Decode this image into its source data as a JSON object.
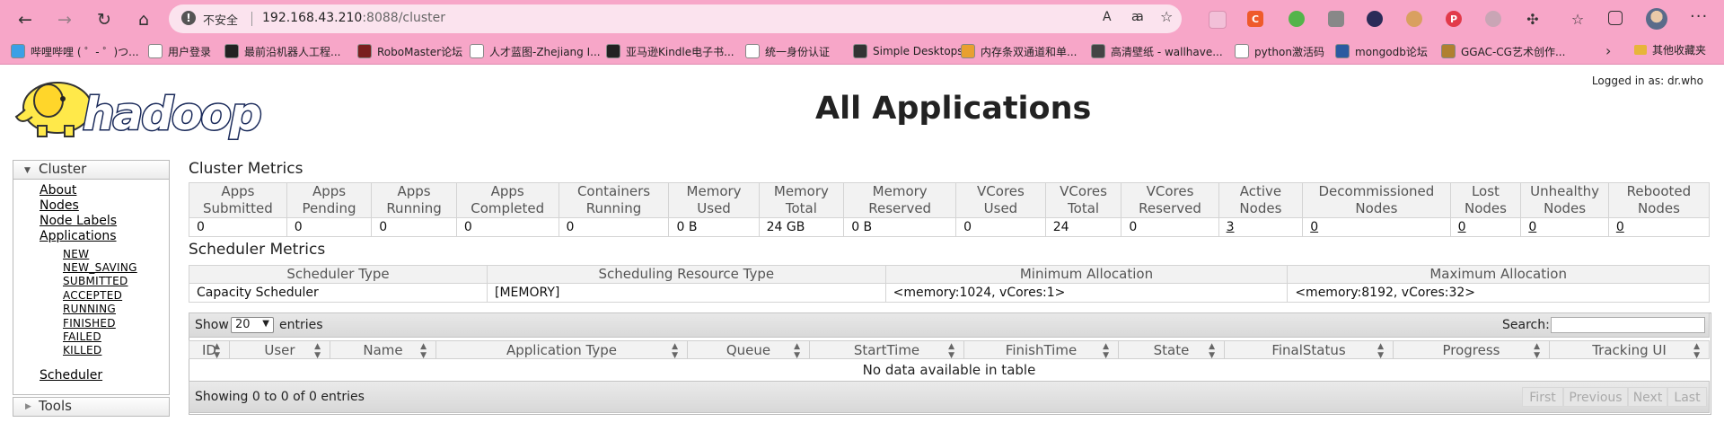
{
  "browser": {
    "back_icon": "←",
    "forward_icon": "→",
    "reload_icon": "↻",
    "home_icon": "⌂",
    "security_label": "不安全",
    "url_host": "192.168.43.210",
    "url_rest": ":8088/cluster",
    "read_aloud_icon": "A",
    "translate_icon": "ꜳ",
    "favorite_icon": "☆",
    "menu_icon": "···",
    "bookmarks": [
      {
        "label": "哔哩哔哩 ( ゜- ゜)つ...",
        "color": "#3aa0e6"
      },
      {
        "label": "用户登录",
        "color": "#ffffff"
      },
      {
        "label": "最前沿机器人工程...",
        "color": "#222222"
      },
      {
        "label": "RoboMaster论坛",
        "color": "#7a1e1e"
      },
      {
        "label": "人才蓝图-Zhejiang I...",
        "color": "#ffffff"
      },
      {
        "label": "亚马逊Kindle电子书...",
        "color": "#222222"
      },
      {
        "label": "统一身份认证",
        "color": "#ffffff"
      },
      {
        "label": "Simple Desktops",
        "color": "#333333"
      },
      {
        "label": "内存条双通道和单...",
        "color": "#e8a030"
      },
      {
        "label": "高清壁纸 - wallhave...",
        "color": "#444444"
      },
      {
        "label": "python激活码",
        "color": "#ffffff"
      },
      {
        "label": "mongodb论坛",
        "color": "#2a5aa0"
      },
      {
        "label": "GGAC-CG艺术创作...",
        "color": "#b08030"
      }
    ],
    "bookmarks_folder": "其他收藏夹"
  },
  "header": {
    "logged_in": "Logged in as: dr.who",
    "title": "All Applications",
    "logo_text": "hadoop"
  },
  "sidebar": {
    "cluster_label": "Cluster",
    "links": [
      "About",
      "Nodes",
      "Node Labels",
      "Applications"
    ],
    "app_states": [
      "NEW",
      "NEW_SAVING",
      "SUBMITTED",
      "ACCEPTED",
      "RUNNING",
      "FINISHED",
      "FAILED",
      "KILLED"
    ],
    "scheduler_link": "Scheduler",
    "tools_label": "Tools"
  },
  "cluster_metrics": {
    "title": "Cluster Metrics",
    "headers": [
      [
        "Apps",
        "Submitted"
      ],
      [
        "Apps",
        "Pending"
      ],
      [
        "Apps",
        "Running"
      ],
      [
        "Apps",
        "Completed"
      ],
      [
        "Containers",
        "Running"
      ],
      [
        "Memory",
        "Used"
      ],
      [
        "Memory",
        "Total"
      ],
      [
        "Memory",
        "Reserved"
      ],
      [
        "VCores",
        "Used"
      ],
      [
        "VCores",
        "Total"
      ],
      [
        "VCores",
        "Reserved"
      ],
      [
        "Active",
        "Nodes"
      ],
      [
        "Decommissioned",
        "Nodes"
      ],
      [
        "Lost",
        "Nodes"
      ],
      [
        "Unhealthy",
        "Nodes"
      ],
      [
        "Rebooted",
        "Nodes"
      ]
    ],
    "values": [
      "0",
      "0",
      "0",
      "0",
      "0",
      "0 B",
      "24 GB",
      "0 B",
      "0",
      "24",
      "0",
      "3",
      "0",
      "0",
      "0",
      "0"
    ]
  },
  "scheduler_metrics": {
    "title": "Scheduler Metrics",
    "headers": [
      "Scheduler Type",
      "Scheduling Resource Type",
      "Minimum Allocation",
      "Maximum Allocation"
    ],
    "values": [
      "Capacity Scheduler",
      "[MEMORY]",
      "<memory:1024, vCores:1>",
      "<memory:8192, vCores:32>"
    ]
  },
  "apps_table": {
    "show_label": "Show",
    "page_size": "20",
    "entries_label": "entries",
    "search_label": "Search:",
    "search_value": "",
    "columns": [
      "ID",
      "User",
      "Name",
      "Application Type",
      "Queue",
      "StartTime",
      "FinishTime",
      "State",
      "FinalStatus",
      "Progress",
      "Tracking UI"
    ],
    "empty_message": "No data available in table",
    "info": "Showing 0 to 0 of 0 entries",
    "pager": [
      "First",
      "Previous",
      "Next",
      "Last"
    ]
  }
}
